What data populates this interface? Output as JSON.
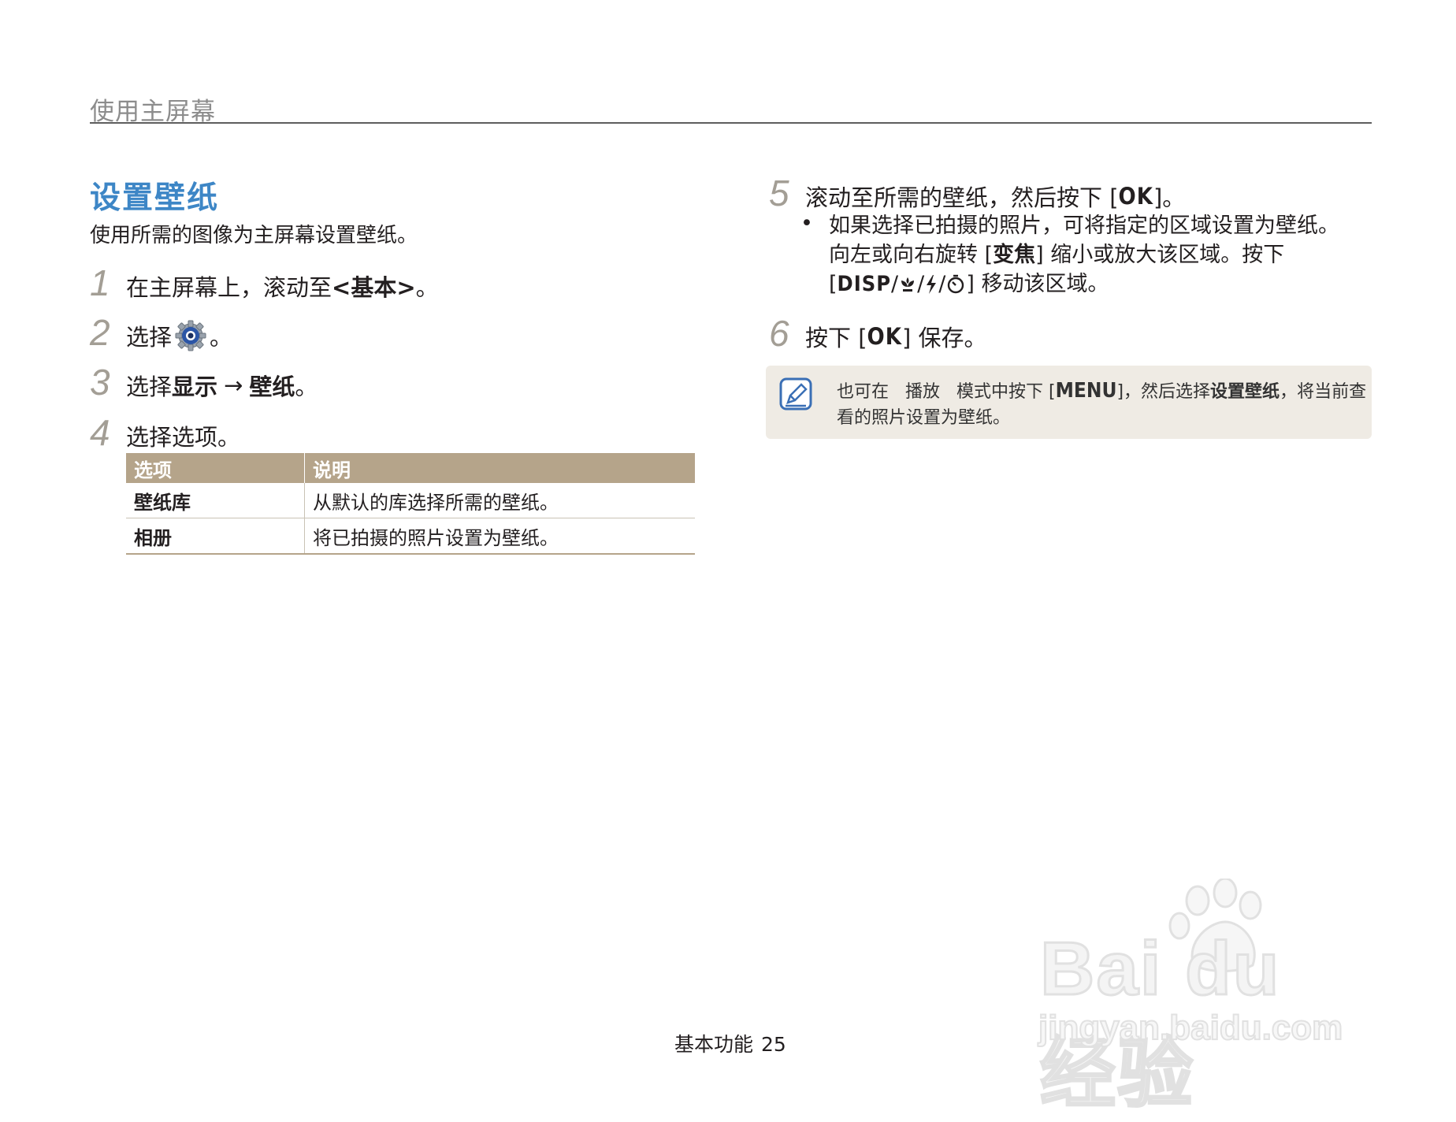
{
  "header": {
    "title": "使用主屏幕"
  },
  "section": {
    "title": "设置壁纸",
    "intro": "使用所需的图像为主屏幕设置壁纸。"
  },
  "steps": [
    {
      "num": "1",
      "text_a": "在主屏幕上，滚动至",
      "text_b": "<基本>",
      "text_c": "。"
    },
    {
      "num": "2",
      "text_a": "选择",
      "icon": "settings-gear-icon",
      "text_c": "。"
    },
    {
      "num": "3",
      "text_a": "选择",
      "text_b": "显示",
      "arrow": "→",
      "text_d": "壁纸",
      "text_c": "。"
    },
    {
      "num": "4",
      "text_a": "选择选项。"
    },
    {
      "num": "5",
      "text_a": "滚动至所需的壁纸，然后按下 [",
      "text_b": "OK",
      "text_c": "]。"
    },
    {
      "num": "6",
      "text_a": "按下 [",
      "text_b": "OK",
      "text_c": "] 保存。"
    }
  ],
  "options_table": {
    "headers": [
      "选项",
      "说明"
    ],
    "rows": [
      [
        "壁纸库",
        "从默认的库选择所需的壁纸。"
      ],
      [
        "相册",
        "将已拍摄的照片设置为壁纸。"
      ]
    ]
  },
  "step5_bullet": {
    "dot": "•",
    "line1": "如果选择已拍摄的照片，可将指定的区域设置为壁纸。",
    "line2_a": "向左或向右旋转 [",
    "line2_b": "变焦",
    "line2_c": "] 缩小或放大该区域。按下",
    "line3_a": "[",
    "line3_b": "DISP",
    "line3_c": "] 移动该区域。",
    "icons": [
      "macro-icon",
      "flash-icon",
      "timer-icon"
    ]
  },
  "note": {
    "icon": "note-pencil-icon",
    "line1_a": "也可在",
    "line1_b": "播放",
    "line1_c": "模式中按下 [",
    "menu": "MENU",
    "line1_d": "]，然后选择",
    "line1_e": "设置壁纸",
    "line1_f": "，将当前查",
    "line2": "看的照片设置为壁纸。"
  },
  "footer": {
    "label": "基本功能",
    "page": "25"
  },
  "watermark": {
    "line1": "Bai du 经验",
    "line2": "jingyan.baidu.com"
  }
}
